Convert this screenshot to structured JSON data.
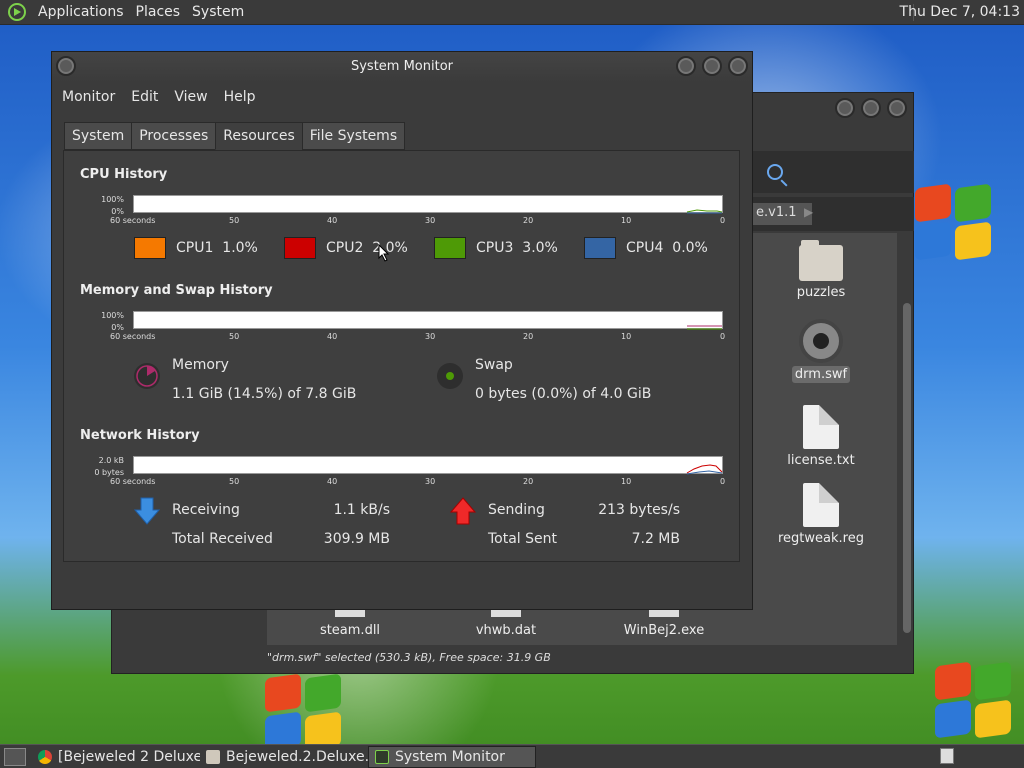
{
  "top_panel": {
    "applications": "Applications",
    "places": "Places",
    "system": "System",
    "clock": "Thu Dec  7, 04:13"
  },
  "file_manager": {
    "path_button": "e.v1.1",
    "files": [
      {
        "name": "puzzles",
        "icon": "folder-icon"
      },
      {
        "name": "drm.swf",
        "icon": "film-reel-icon"
      },
      {
        "name": "license.txt",
        "icon": "document-icon"
      },
      {
        "name": "regtweak.reg",
        "icon": "document-icon"
      },
      {
        "name": "steam.dll",
        "icon": "document-icon"
      },
      {
        "name": "vhwb.dat",
        "icon": "document-icon"
      },
      {
        "name": "WinBej2.exe",
        "icon": "document-icon"
      }
    ],
    "status": "\"drm.swf\" selected (530.3 kB), Free space: 31.9 GB"
  },
  "system_monitor": {
    "title": "System Monitor",
    "menu": [
      "Monitor",
      "Edit",
      "View",
      "Help"
    ],
    "tabs": [
      "System",
      "Processes",
      "Resources",
      "File Systems"
    ],
    "active_tab": "Resources",
    "cpu": {
      "title": "CPU History",
      "y_top": "100%",
      "y_bottom": "0%",
      "x_labels": [
        "60 seconds",
        "50",
        "40",
        "30",
        "20",
        "10",
        "0"
      ],
      "cores": [
        {
          "label": "CPU1",
          "value": "1.0%",
          "color": "#f57900"
        },
        {
          "label": "CPU2",
          "value": "2.0%",
          "color": "#cc0000"
        },
        {
          "label": "CPU3",
          "value": "3.0%",
          "color": "#4e9a06"
        },
        {
          "label": "CPU4",
          "value": "0.0%",
          "color": "#3465a4"
        }
      ]
    },
    "memory": {
      "title": "Memory and Swap History",
      "y_top": "100%",
      "y_bottom": "0%",
      "x_labels": [
        "60 seconds",
        "50",
        "40",
        "30",
        "20",
        "10",
        "0"
      ],
      "memory_label": "Memory",
      "memory_value": "1.1 GiB (14.5%) of 7.8 GiB",
      "memory_color": "#ad2b6a",
      "swap_label": "Swap",
      "swap_value": "0 bytes (0.0%) of 4.0 GiB",
      "swap_color": "#4e9a06"
    },
    "network": {
      "title": "Network History",
      "y_top": "2.0 kB",
      "y_bottom": "0 bytes",
      "x_labels": [
        "60 seconds",
        "50",
        "40",
        "30",
        "20",
        "10",
        "0"
      ],
      "receiving_label": "Receiving",
      "receiving_value": "1.1 kB/s",
      "total_received_label": "Total Received",
      "total_received_value": "309.9 MB",
      "sending_label": "Sending",
      "sending_value": "213 bytes/s",
      "total_sent_label": "Total Sent",
      "total_sent_value": "7.2 MB",
      "receiving_color": "#3b8ee0",
      "sending_color": "#ef2929"
    }
  },
  "taskbar": {
    "items": [
      {
        "label": "[Bejeweled 2 Deluxe...",
        "icon": "browser-icon"
      },
      {
        "label": "Bejeweled.2.Deluxe....",
        "icon": "folder-icon"
      },
      {
        "label": "System Monitor",
        "icon": "system-monitor-icon"
      }
    ]
  }
}
